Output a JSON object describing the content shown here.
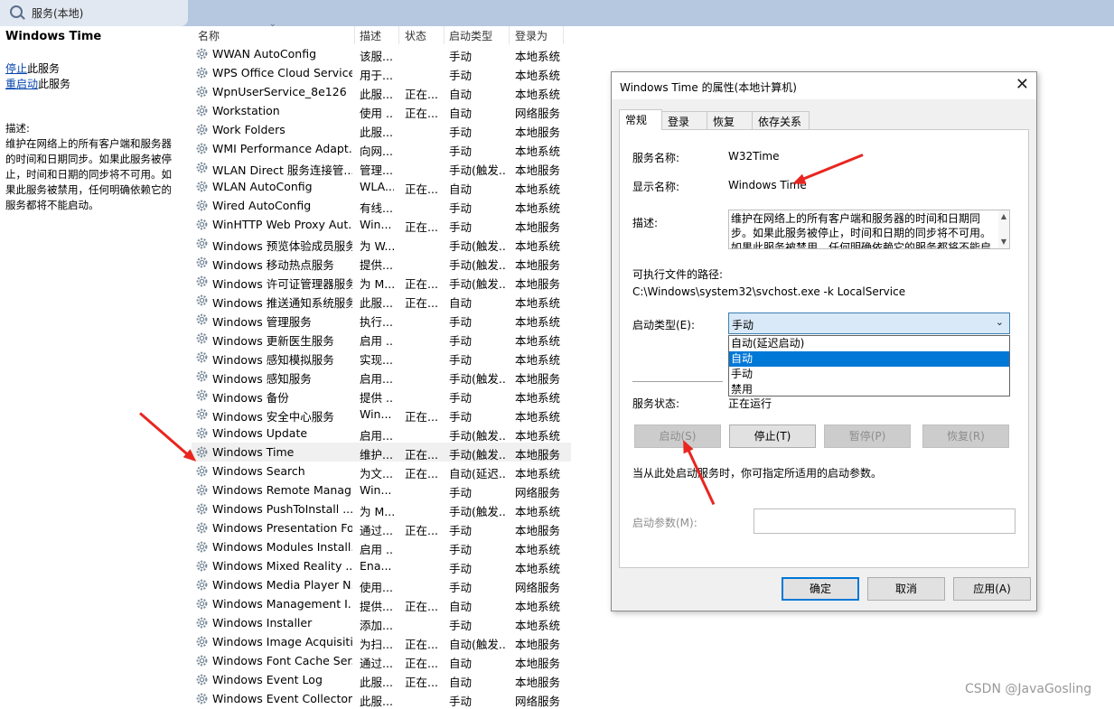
{
  "window": {
    "title": "服务(本地)"
  },
  "left": {
    "service_name": "Windows Time",
    "stop_link": "停止",
    "stop_suffix": "此服务",
    "restart_link": "重启动",
    "restart_suffix": "此服务",
    "desc_label": "描述:",
    "desc_text": "维护在网络上的所有客户端和服务器的时间和日期同步。如果此服务被停止，时间和日期的同步将不可用。如果此服务被禁用，任何明确依赖它的服务都将不能启动。"
  },
  "columns": [
    "名称",
    "描述",
    "状态",
    "启动类型",
    "登录为"
  ],
  "rows": [
    [
      "WWAN AutoConfig",
      "该服...",
      "",
      "手动",
      "本地系统"
    ],
    [
      "WPS Office Cloud Service",
      "用于...",
      "",
      "手动",
      "本地系统"
    ],
    [
      "WpnUserService_8e126",
      "此服...",
      "正在...",
      "自动",
      "本地系统"
    ],
    [
      "Workstation",
      "使用 ...",
      "正在...",
      "自动",
      "网络服务"
    ],
    [
      "Work Folders",
      "此服...",
      "",
      "手动",
      "本地服务"
    ],
    [
      "WMI Performance Adapt...",
      "向网...",
      "",
      "手动",
      "本地系统"
    ],
    [
      "WLAN Direct 服务连接管...",
      "管理...",
      "",
      "手动(触发...",
      "本地服务"
    ],
    [
      "WLAN AutoConfig",
      "WLA...",
      "正在...",
      "自动",
      "本地系统"
    ],
    [
      "Wired AutoConfig",
      "有线...",
      "",
      "手动",
      "本地系统"
    ],
    [
      "WinHTTP Web Proxy Aut...",
      "Win...",
      "正在...",
      "手动",
      "本地服务"
    ],
    [
      "Windows 预览体验成员服务",
      "为 W...",
      "",
      "手动(触发...",
      "本地系统"
    ],
    [
      "Windows 移动热点服务",
      "提供...",
      "",
      "手动(触发...",
      "本地服务"
    ],
    [
      "Windows 许可证管理器服务",
      "为 M...",
      "正在...",
      "手动(触发...",
      "本地服务"
    ],
    [
      "Windows 推送通知系统服务",
      "此服...",
      "正在...",
      "自动",
      "本地系统"
    ],
    [
      "Windows 管理服务",
      "执行...",
      "",
      "手动",
      "本地系统"
    ],
    [
      "Windows 更新医生服务",
      "启用 ...",
      "",
      "手动",
      "本地系统"
    ],
    [
      "Windows 感知模拟服务",
      "实现...",
      "",
      "手动",
      "本地系统"
    ],
    [
      "Windows 感知服务",
      "启用...",
      "",
      "手动(触发...",
      "本地服务"
    ],
    [
      "Windows 备份",
      "提供 ...",
      "",
      "手动",
      "本地系统"
    ],
    [
      "Windows 安全中心服务",
      "Win...",
      "正在...",
      "手动",
      "本地系统"
    ],
    [
      "Windows Update",
      "启用...",
      "",
      "手动(触发...",
      "本地系统"
    ],
    [
      "Windows Time",
      "维护...",
      "正在...",
      "手动(触发...",
      "本地服务"
    ],
    [
      "Windows Search",
      "为文...",
      "正在...",
      "自动(延迟...",
      "本地系统"
    ],
    [
      "Windows Remote Manag...",
      "Win...",
      "",
      "手动",
      "网络服务"
    ],
    [
      "Windows PushToInstall ...",
      "为 M...",
      "",
      "手动(触发...",
      "本地系统"
    ],
    [
      "Windows Presentation Fo...",
      "通过...",
      "正在...",
      "手动",
      "本地服务"
    ],
    [
      "Windows Modules Install...",
      "启用 ...",
      "",
      "手动",
      "本地系统"
    ],
    [
      "Windows Mixed Reality ...",
      "Ena...",
      "",
      "手动",
      "本地系统"
    ],
    [
      "Windows Media Player N...",
      "使用...",
      "",
      "手动",
      "网络服务"
    ],
    [
      "Windows Management I...",
      "提供...",
      "正在...",
      "自动",
      "本地系统"
    ],
    [
      "Windows Installer",
      "添加...",
      "",
      "手动",
      "本地系统"
    ],
    [
      "Windows Image Acquisiti...",
      "为扫...",
      "正在...",
      "自动(触发...",
      "本地服务"
    ],
    [
      "Windows Font Cache Ser...",
      "通过...",
      "正在...",
      "自动",
      "本地服务"
    ],
    [
      "Windows Event Log",
      "此服...",
      "正在...",
      "自动",
      "本地服务"
    ],
    [
      "Windows Event Collector",
      "此服...",
      "",
      "手动",
      "网络服务"
    ]
  ],
  "dialog": {
    "title": "Windows Time 的属性(本地计算机)",
    "close": "✕",
    "tabs": [
      "常规",
      "登录",
      "恢复",
      "依存关系"
    ],
    "service_name_label": "服务名称:",
    "service_name": "W32Time",
    "display_name_label": "显示名称:",
    "display_name": "Windows Time",
    "desc_label": "描述:",
    "desc": "维护在网络上的所有客户端和服务器的时间和日期同步。如果此服务被停止，时间和日期的同步将不可用。如果此服务被禁用，任何明确依赖它的服务都将不能启动。",
    "path_label": "可执行文件的路径:",
    "path": "C:\\Windows\\system32\\svchost.exe -k LocalService",
    "startup_label": "启动类型(E):",
    "startup_value": "手动",
    "startup_options": [
      "自动(延迟启动)",
      "自动",
      "手动",
      "禁用"
    ],
    "status_label": "服务状态:",
    "status_value": "正在运行",
    "start_btn": "启动(S)",
    "stop_btn": "停止(T)",
    "pause_btn": "暂停(P)",
    "resume_btn": "恢复(R)",
    "hint": "当从此处启动服务时，你可指定所适用的启动参数。",
    "params_label": "启动参数(M):",
    "ok": "确定",
    "cancel": "取消",
    "apply": "应用(A)"
  },
  "watermark": "CSDN @JavaGosling",
  "colors": {
    "accent": "#0078d7",
    "arrow": "#e8261f",
    "titlebar": "#b6c7e0"
  }
}
